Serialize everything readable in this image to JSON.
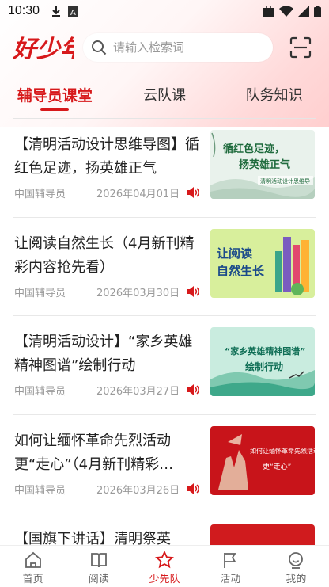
{
  "status_bar": {
    "time": "10:30",
    "icons": [
      "download-icon",
      "a-box-icon",
      "briefcase-icon",
      "wifi-icon",
      "signal-icon",
      "battery-icon"
    ]
  },
  "header": {
    "logo_text": "好少年",
    "search": {
      "placeholder": "请输入检索词"
    },
    "scan_icon": "scan-icon"
  },
  "tabs": [
    {
      "label": "辅导员课堂",
      "active": true
    },
    {
      "label": "云队课",
      "active": false
    },
    {
      "label": "队务知识",
      "active": false
    }
  ],
  "articles": [
    {
      "title": "【清明活动设计思维导图】循红色足迹，扬英雄正气",
      "source": "中国辅导员",
      "date": "2026年04月01日",
      "thumb_lines": [
        "循红色足迹，",
        "扬英雄正气"
      ],
      "thumb_caption": "清明活动设计思维导"
    },
    {
      "title": "让阅读自然生长（4月新刊精彩内容抢先看）",
      "source": "中国辅导员",
      "date": "2026年03月30日",
      "thumb_lines": [
        "让阅读",
        "自然生长"
      ]
    },
    {
      "title": "【清明活动设计】“家乡英雄精神图谱”绘制行动",
      "source": "中国辅导员",
      "date": "2026年03月27日",
      "thumb_lines": [
        "“家乡英雄精神图谱”",
        "绘制行动"
      ]
    },
    {
      "title": "如何让缅怀革命先烈活动更“走心”（4月新刊精彩…",
      "source": "中国辅导员",
      "date": "2026年03月26日",
      "thumb_lines": [
        "如何让缅怀革命先烈活动",
        "更“走心”"
      ]
    },
    {
      "title": "【国旗下讲话】清明祭英",
      "source": "",
      "date": ""
    }
  ],
  "bottom_nav": [
    {
      "label": "首页",
      "icon": "home-icon",
      "active": false
    },
    {
      "label": "阅读",
      "icon": "book-icon",
      "active": false
    },
    {
      "label": "少先队",
      "icon": "star-icon",
      "active": true
    },
    {
      "label": "活动",
      "icon": "flag-icon",
      "active": false
    },
    {
      "label": "我的",
      "icon": "profile-icon",
      "active": false
    }
  ],
  "colors": {
    "accent": "#d7191b",
    "text": "#222222",
    "meta": "#9a9a9a"
  }
}
